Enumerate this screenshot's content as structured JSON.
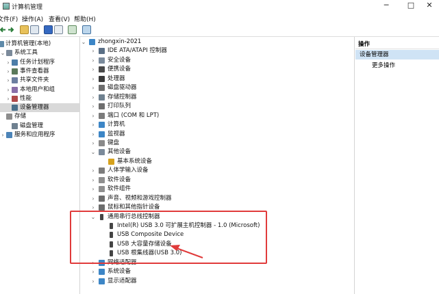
{
  "window": {
    "title": "计算机管理",
    "minimize_glyph": "─",
    "maximize_glyph": "□",
    "close_glyph": "✕"
  },
  "menu": [
    "文件(F)",
    "操作(A)",
    "查看(V)",
    "帮助(H)"
  ],
  "toolbar_icons": [
    "back-arrow-icon",
    "forward-arrow-icon",
    "folder-up-icon",
    "show-hide-tree-icon",
    "help-icon",
    "properties-icon",
    "refresh-icon",
    "monitor-icon"
  ],
  "left_tree": {
    "root": "计算机管理(本地)",
    "items": [
      {
        "label": "系统工具",
        "level": 1,
        "expanded": true
      },
      {
        "label": "任务计划程序",
        "level": 2
      },
      {
        "label": "事件查看器",
        "level": 2
      },
      {
        "label": "共享文件夹",
        "level": 2
      },
      {
        "label": "本地用户和组",
        "level": 2
      },
      {
        "label": "性能",
        "level": 2
      },
      {
        "label": "设备管理器",
        "level": 2,
        "selected": true
      },
      {
        "label": "存储",
        "level": 1,
        "expanded": true
      },
      {
        "label": "磁盘管理",
        "level": 2
      },
      {
        "label": "服务和应用程序",
        "level": 1
      }
    ]
  },
  "device_tree": {
    "computer": "zhongxin-2021",
    "categories": [
      {
        "label": "IDE ATA/ATAPI 控制器",
        "icon": "ide-controller-icon"
      },
      {
        "label": "安全设备",
        "icon": "security-device-icon"
      },
      {
        "label": "便携设备",
        "icon": "portable-device-icon"
      },
      {
        "label": "处理器",
        "icon": "processor-icon"
      },
      {
        "label": "磁盘驱动器",
        "icon": "disk-drive-icon"
      },
      {
        "label": "存储控制器",
        "icon": "storage-controller-icon"
      },
      {
        "label": "打印队列",
        "icon": "printer-icon"
      },
      {
        "label": "端口 (COM 和 LPT)",
        "icon": "port-icon"
      },
      {
        "label": "计算机",
        "icon": "computer-icon"
      },
      {
        "label": "监视器",
        "icon": "monitor-icon"
      },
      {
        "label": "键盘",
        "icon": "keyboard-icon"
      },
      {
        "label": "其他设备",
        "icon": "other-device-icon",
        "expanded": true,
        "children": [
          {
            "label": "基本系统设备",
            "icon": "warning-device-icon"
          }
        ]
      },
      {
        "label": "人体学输入设备",
        "icon": "hid-icon"
      },
      {
        "label": "软件设备",
        "icon": "software-device-icon"
      },
      {
        "label": "软件组件",
        "icon": "software-component-icon"
      },
      {
        "label": "声音、视频和游戏控制器",
        "icon": "audio-icon"
      },
      {
        "label": "鼠标和其他指针设备",
        "icon": "mouse-icon"
      },
      {
        "label": "通用串行总线控制器",
        "icon": "usb-icon",
        "expanded": true,
        "children": [
          {
            "label": "Intel(R) USB 3.0 可扩展主机控制器 - 1.0 (Microsoft)",
            "icon": "usb-icon"
          },
          {
            "label": "USB Composite Device",
            "icon": "usb-icon"
          },
          {
            "label": "USB 大容量存储设备",
            "icon": "usb-icon"
          },
          {
            "label": "USB 根集线器(USB 3.0)",
            "icon": "usb-icon"
          }
        ]
      },
      {
        "label": "网络适配器",
        "icon": "network-adapter-icon"
      },
      {
        "label": "系统设备",
        "icon": "system-device-icon"
      },
      {
        "label": "显示适配器",
        "icon": "display-adapter-icon"
      }
    ]
  },
  "actions_pane": {
    "title": "操作",
    "selected": "设备管理器",
    "more": "更多操作"
  },
  "colors": {
    "annotation": "#e03a3a",
    "selection": "#cfe3f5",
    "tree_selected": "#d9d9d9"
  }
}
